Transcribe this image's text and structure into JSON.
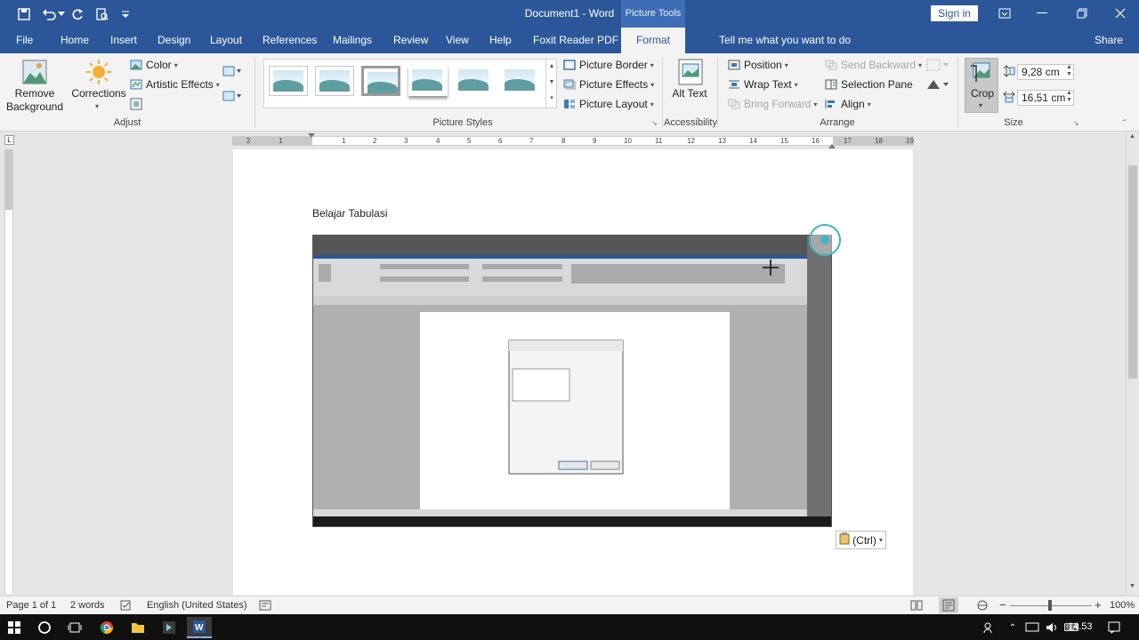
{
  "window": {
    "title": "Document1  -  Word",
    "contextual_tab_group": "Picture Tools",
    "sign_in": "Sign in"
  },
  "tabs": [
    "File",
    "Home",
    "Insert",
    "Design",
    "Layout",
    "References",
    "Mailings",
    "Review",
    "View",
    "Help",
    "Foxit Reader PDF",
    "Format"
  ],
  "active_tab": "Format",
  "tell_me": "Tell me what you want to do",
  "share": "Share",
  "ribbon": {
    "adjust": {
      "remove_background": "Remove Background",
      "corrections": "Corrections",
      "color": "Color",
      "artistic_effects": "Artistic Effects",
      "label": "Adjust"
    },
    "picture_styles": {
      "picture_border": "Picture Border",
      "picture_effects": "Picture Effects",
      "picture_layout": "Picture Layout",
      "label": "Picture Styles"
    },
    "accessibility": {
      "alt_text": "Alt Text",
      "label": "Accessibility"
    },
    "arrange": {
      "position": "Position",
      "wrap_text": "Wrap Text",
      "bring_forward": "Bring Forward",
      "send_backward": "Send Backward",
      "selection_pane": "Selection Pane",
      "align": "Align",
      "label": "Arrange"
    },
    "size": {
      "crop": "Crop",
      "height": "9,28 cm",
      "width": "16,51 cm",
      "label": "Size"
    }
  },
  "ruler": {
    "numbers": [
      "2",
      "1",
      "1",
      "2",
      "3",
      "4",
      "5",
      "6",
      "7",
      "8",
      "9",
      "10",
      "11",
      "12",
      "13",
      "14",
      "15",
      "16",
      "17",
      "18",
      "19"
    ]
  },
  "document": {
    "text": "Belajar Tabulasi",
    "paste_options": "(Ctrl)"
  },
  "status": {
    "page": "Page 1 of 1",
    "words": "2 words",
    "language": "English (United States)",
    "zoom": "100%"
  },
  "taskbar": {
    "time": "14.53"
  }
}
